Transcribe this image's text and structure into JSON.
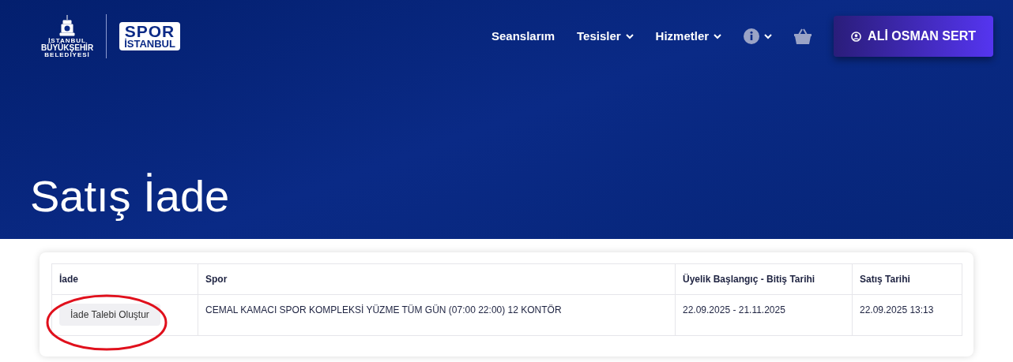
{
  "logo": {
    "municipality": [
      "İSTANBUL",
      "BÜYÜKŞEHİR",
      "BELEDİYESİ"
    ],
    "brand": [
      "SPOR",
      "İSTANBUL"
    ]
  },
  "nav": [
    {
      "label": "Seanslarım",
      "kind": "link"
    },
    {
      "label": "Tesisler",
      "kind": "dropdown"
    },
    {
      "label": "Hizmetler",
      "kind": "dropdown"
    },
    {
      "kind": "info"
    },
    {
      "kind": "cart"
    }
  ],
  "user_button": "ALİ OSMAN SERT",
  "page_title": "Satış İade",
  "table": {
    "columns": [
      "İade",
      "Spor",
      "Üyelik Başlangıç - Bitiş Tarihi",
      "Satış Tarihi"
    ],
    "rows": [
      {
        "action": "İade Talebi Oluştur",
        "sport": "CEMAL KAMACI SPOR KOMPLEKSİ YÜZME TÜM GÜN (07:00 22:00) 12 KONTÖR",
        "period": "22.09.2025 - 21.11.2025",
        "sale_date": "22.09.2025 13:13",
        "highlighted": true
      }
    ]
  }
}
